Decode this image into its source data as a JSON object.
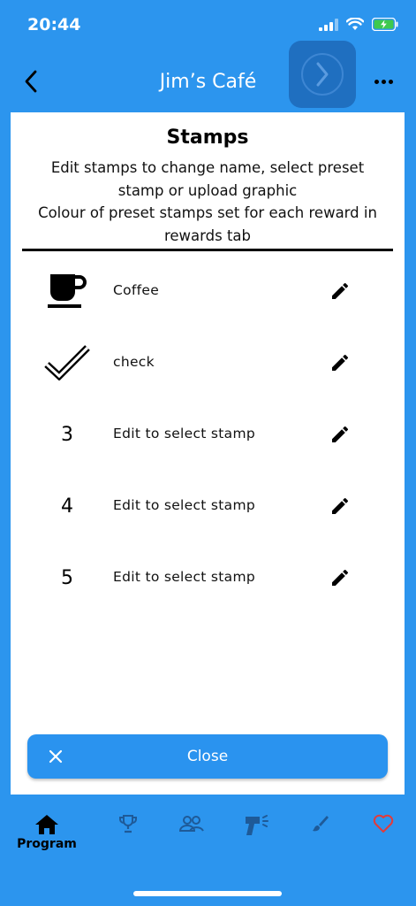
{
  "status_bar": {
    "time": "20:44",
    "icons": [
      "cellular-icon",
      "wifi-icon",
      "battery-charging-icon"
    ]
  },
  "header": {
    "title": "Jim’s Café",
    "back_icon": "chevron-left-icon",
    "overlay_icon": "chevron-right-circle-icon",
    "more_icon": "more-horizontal-icon"
  },
  "sheet": {
    "title": "Stamps",
    "description_lines": [
      "Edit stamps to change name, select preset",
      "stamp or upload graphic",
      "Colour of preset stamps set for each reward in",
      "rewards tab"
    ],
    "stamps": [
      {
        "icon": "coffee-cup-icon",
        "number": "",
        "label": "Coffee"
      },
      {
        "icon": "check-icon",
        "number": "",
        "label": "check"
      },
      {
        "icon": "",
        "number": "3",
        "label": "Edit to select stamp"
      },
      {
        "icon": "",
        "number": "4",
        "label": "Edit to select stamp"
      },
      {
        "icon": "",
        "number": "5",
        "label": "Edit to select stamp"
      }
    ],
    "edit_icon": "pencil-icon",
    "close_label": "Close"
  },
  "bottom_nav": {
    "items": [
      {
        "icon": "home-icon",
        "label": "Program",
        "active": true
      },
      {
        "icon": "trophy-icon",
        "label": ""
      },
      {
        "icon": "users-icon",
        "label": ""
      },
      {
        "icon": "scanner-icon",
        "label": ""
      },
      {
        "icon": "brush-icon",
        "label": ""
      },
      {
        "icon": "heart-icon",
        "label": ""
      }
    ]
  },
  "colors": {
    "primary": "#2c95ee",
    "button": "#2a93ef",
    "overlay": "#1f6fc0",
    "nav_icon": "#1e5a98",
    "heart": "#e23b3b"
  }
}
